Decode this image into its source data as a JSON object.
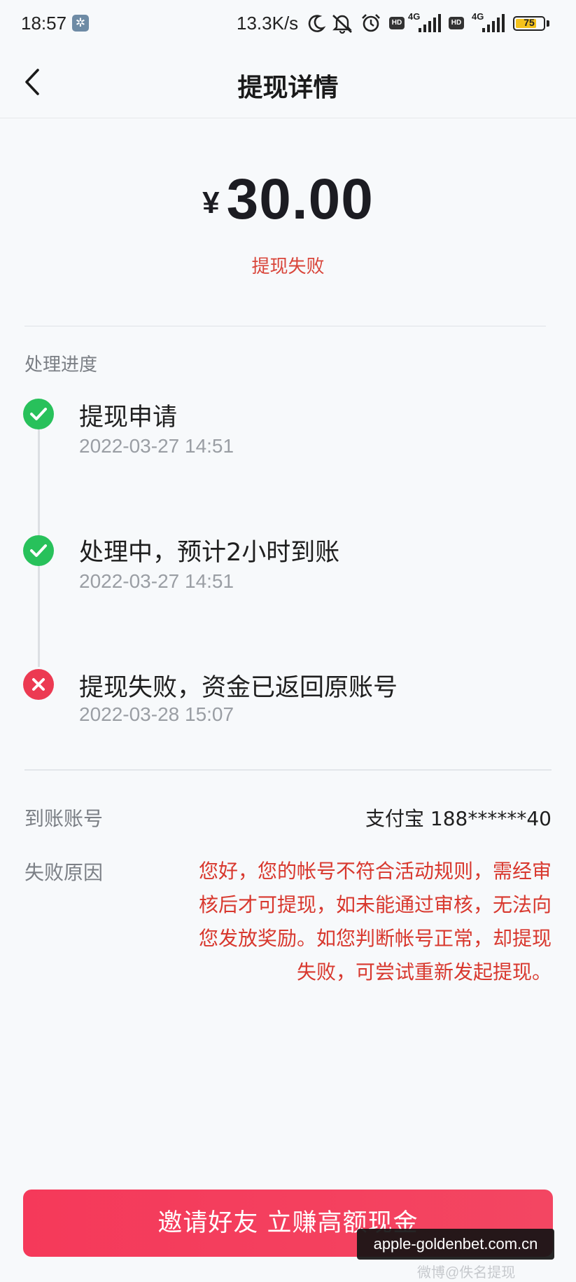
{
  "status_bar": {
    "time": "18:57",
    "net_speed": "13.3K/s",
    "hd_label": "HD",
    "network_type": "4G",
    "battery_level": "75",
    "battery_fraction": 0.75,
    "icons": [
      "gear-icon",
      "moon-icon",
      "mute-icon",
      "alarm-icon",
      "hd-icon",
      "signal-icon",
      "battery-icon"
    ]
  },
  "header": {
    "title": "提现详情",
    "back_icon": "chevron-left-icon"
  },
  "amount": {
    "currency": "¥",
    "value": "30.00",
    "status": "提现失败"
  },
  "progress": {
    "section_title": "处理进度",
    "steps": [
      {
        "title": "提现申请",
        "time": "2022-03-27 14:51",
        "state": "success"
      },
      {
        "title": "处理中，预计2小时到账",
        "time": "2022-03-27 14:51",
        "state": "success"
      },
      {
        "title": "提现失败，资金已返回原账号",
        "time": "2022-03-28 15:07",
        "state": "failed"
      }
    ]
  },
  "details": {
    "account_label": "到账账号",
    "account_value": "支付宝 188******40",
    "reason_label": "失败原因",
    "reason_text": "您好，您的帐号不符合活动规则，需经审核后才可提现，如未能通过审核，无法向您发放奖励。如您判断帐号正常，却提现失败，可尝试重新发起提现。"
  },
  "bottom": {
    "invite_label": "邀请好友 立赚高额现金"
  },
  "overlay": {
    "watermark": "apple-goldenbet.com.cn",
    "weibo_handle": "微博@佚名提现"
  },
  "colors": {
    "success": "#28c15b",
    "error": "#ec3a52",
    "error_text": "#d8382e",
    "button": "#f43f5e",
    "battery": "#f4c21b"
  }
}
